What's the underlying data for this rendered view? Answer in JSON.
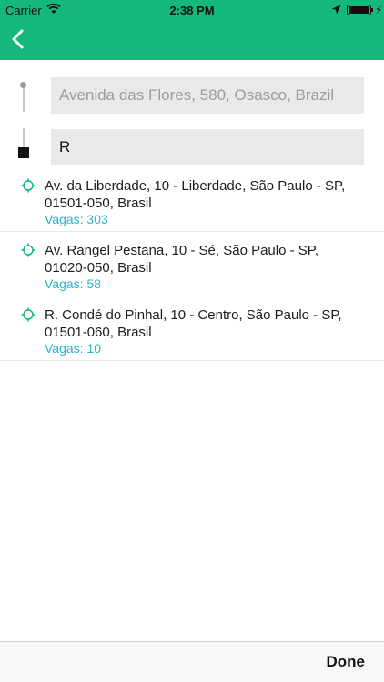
{
  "status_bar": {
    "carrier": "Carrier",
    "time": "2:38 PM"
  },
  "nav": {
    "back_icon": "chevron-left-icon",
    "background_color": "#14b87a"
  },
  "route": {
    "origin_placeholder": "Avenida das Flores, 580, Osasco, Brazil",
    "destination_value": "R"
  },
  "results": [
    {
      "address": "Av. da Liberdade, 10 - Liberdade, São Paulo - SP, 01501-050, Brasil",
      "vagas": "Vagas: 303"
    },
    {
      "address": "Av. Rangel Pestana, 10 - Sé, São Paulo - SP, 01020-050, Brasil",
      "vagas": "Vagas: 58"
    },
    {
      "address": "R. Condé do Pinhal, 10 - Centro, São Paulo - SP, 01501-060, Brasil",
      "vagas": "Vagas: 10"
    }
  ],
  "toolbar": {
    "done_label": "Done"
  },
  "colors": {
    "accent": "#14b87a",
    "vagas_text": "#2bb4cc"
  }
}
